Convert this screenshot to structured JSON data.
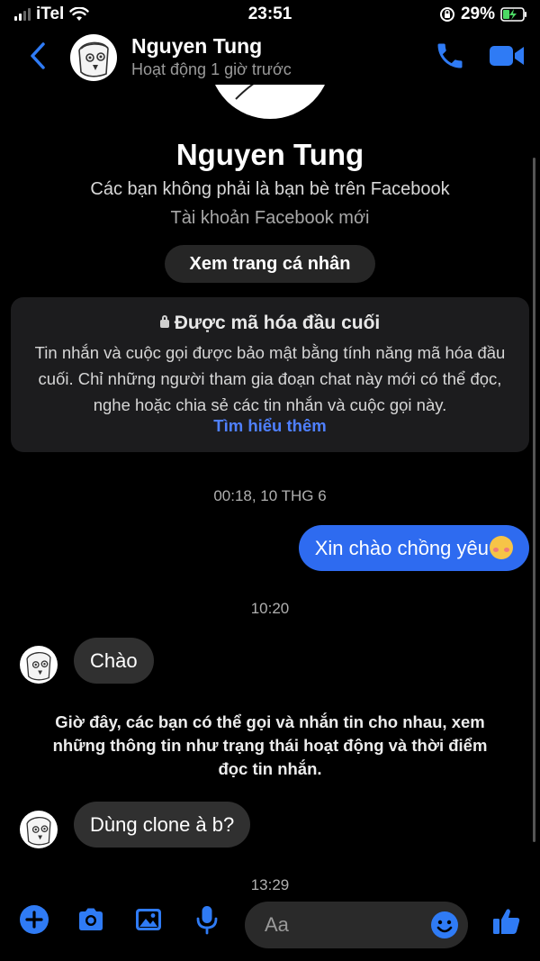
{
  "status_bar": {
    "carrier": "iTel",
    "time": "23:51",
    "battery": "29%"
  },
  "header": {
    "name": "Nguyen Tung",
    "status": "Hoạt động 1 giờ trước"
  },
  "profile": {
    "name": "Nguyen Tung",
    "relation": "Các bạn không phải là bạn bè trên Facebook",
    "account": "Tài khoản Facebook mới",
    "view_profile_label": "Xem trang cá nhân"
  },
  "encryption": {
    "title": "Được mã hóa đầu cuối",
    "body": "Tin nhắn và cuộc gọi được bảo mật bằng tính năng mã hóa đầu cuối. Chỉ những người tham gia đoạn chat này mới có thể đọc, nghe hoặc chia sẻ các tin nhắn và cuộc gọi này.",
    "link": "Tìm hiểu thêm"
  },
  "messages": {
    "ts1": "00:18, 10 THG 6",
    "out1": "Xin chào chồng yêu",
    "ts2": "10:20",
    "in1": "Chào",
    "notice": "Giờ đây, các bạn có thể gọi và nhắn tin cho nhau, xem những thông tin như trạng thái hoạt động và thời điểm đọc tin nhắn.",
    "in2": "Dùng clone à b?",
    "ts3": "13:29"
  },
  "composer": {
    "placeholder": "Aa"
  },
  "colors": {
    "accent": "#2e6bf0",
    "link": "#4f80ff",
    "bubble_in": "#303030",
    "background": "#000000"
  },
  "icons": [
    "back-chevron-icon",
    "phone-icon",
    "video-camera-icon",
    "lock-icon",
    "plus-icon",
    "camera-icon",
    "gallery-icon",
    "microphone-icon",
    "smile-icon",
    "thumbs-up-icon"
  ]
}
